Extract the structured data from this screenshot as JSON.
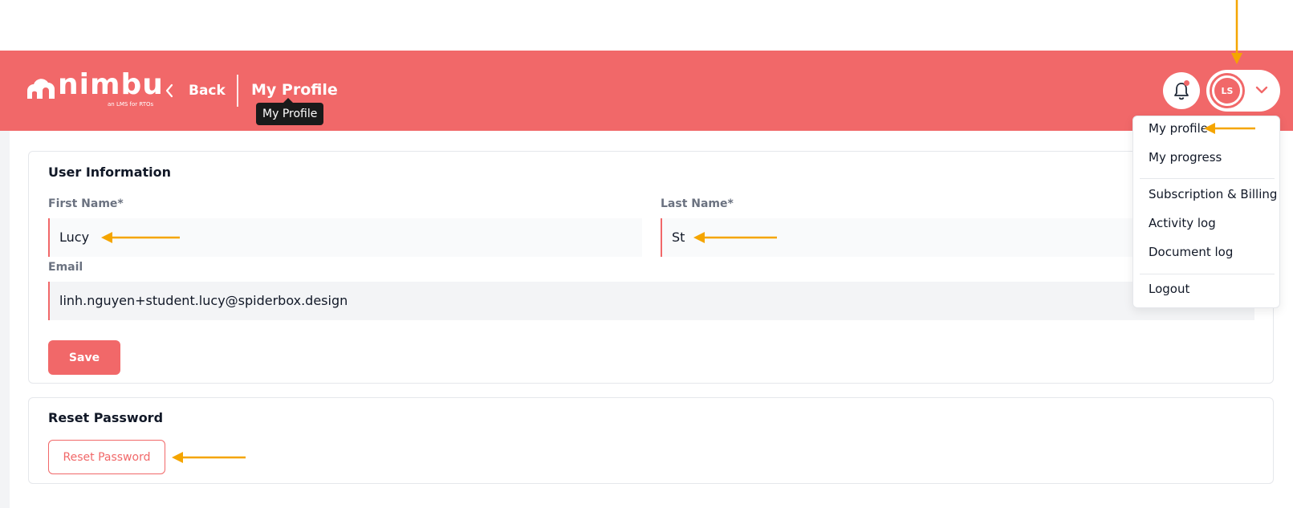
{
  "header": {
    "logo_text": "nimbu",
    "logo_tagline": "an LMS for RTOs",
    "back_label": "Back",
    "page_title": "My Profile",
    "tooltip": "My Profile",
    "avatar_initials": "LS",
    "notification_indicator": true
  },
  "user_info": {
    "title": "User Information",
    "first_name_label": "First Name*",
    "first_name_value": "Lucy",
    "last_name_label": "Last Name*",
    "last_name_value": "St",
    "email_label": "Email",
    "email_value": "linh.nguyen+student.lucy@spiderbox.design",
    "save_label": "Save"
  },
  "reset_password": {
    "title": "Reset Password",
    "button_label": "Reset Password"
  },
  "user_menu": {
    "items": [
      "My profile",
      "My progress",
      "Subscription & Billing",
      "Activity log",
      "Document log",
      "Logout"
    ]
  },
  "colors": {
    "brand": "#f16869",
    "annotation_arrow": "#f5a500",
    "tooltip_bg": "#1a1a1a"
  },
  "icons": [
    "cloud-logo-icon",
    "chevron-left-icon",
    "bell-icon",
    "chevron-down-icon",
    "annotation-arrow-icon"
  ]
}
